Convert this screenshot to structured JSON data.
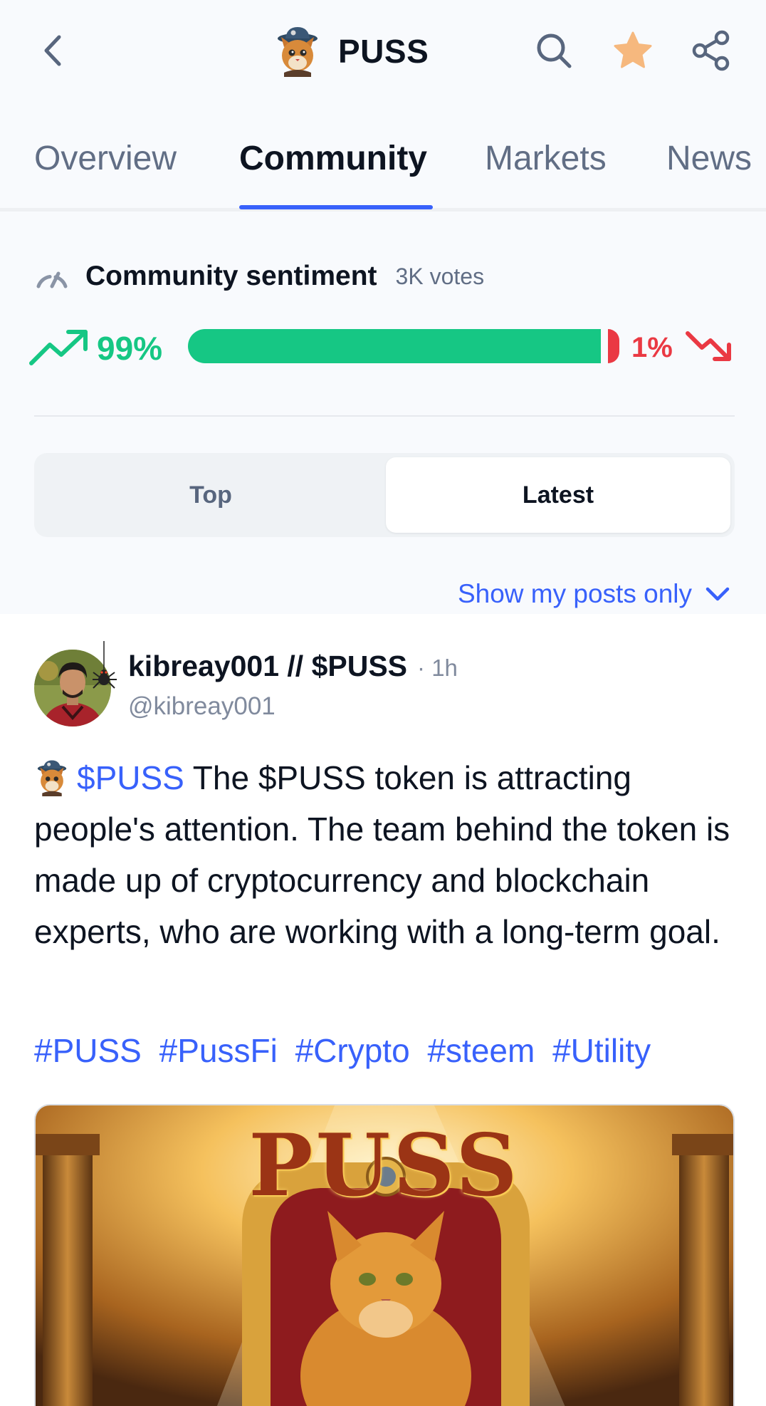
{
  "header": {
    "title": "PUSS",
    "icons": [
      "chevron-left-icon",
      "coin-logo",
      "search-icon",
      "star-icon",
      "share-icon"
    ],
    "star_color": "#f6b87e"
  },
  "tabs": [
    {
      "label": "Overview",
      "active": false
    },
    {
      "label": "Community",
      "active": true
    },
    {
      "label": "Markets",
      "active": false
    },
    {
      "label": "News",
      "active": false
    }
  ],
  "sentiment": {
    "title": "Community sentiment",
    "votes": "3K votes",
    "bullish_label": "99%",
    "bearish_label": "1%",
    "bullish_fraction": 0.99,
    "bearish_fraction": 0.01,
    "bullish_color": "#16c784",
    "bearish_color": "#ea3943"
  },
  "sort": {
    "options": [
      "Top",
      "Latest"
    ],
    "selected": "Latest"
  },
  "filter": {
    "label": "Show my posts only"
  },
  "post": {
    "author": "kibreay001 // $PUSS",
    "time": "· 1h",
    "handle": "@kibreay001",
    "cashtag": "$PUSS",
    "text": " The $PUSS token is attracting people's attention. The team behind the token is made up of cryptocurrency and blockchain experts, who are working with a long-term goal.",
    "hashtags": [
      "#PUSS",
      "#PussFi",
      "#Crypto",
      "#steem",
      "#Utility"
    ],
    "image_text": "PUSS"
  },
  "accent_color": "#3861fb"
}
